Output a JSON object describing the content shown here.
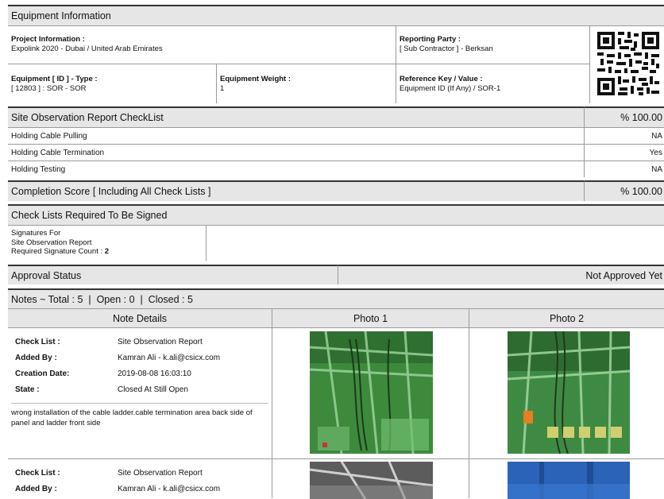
{
  "equipment_info": {
    "title": "Equipment Information",
    "project_label": "Project Information :",
    "project_value": "Expolink 2020 - Dubai / United Arab Emirates",
    "reporting_label": "Reporting Party :",
    "reporting_value": "[ Sub Contractor ] - Berksan",
    "equip_label": "Equipment [ ID ] - Type :",
    "equip_value": "[ 12803 ] : SOR - SOR",
    "weight_label": "Equipment Weight :",
    "weight_value": "1",
    "refkey_label": "Reference Key / Value :",
    "refkey_value": "Equipment ID (If Any) / SOR-1",
    "qr_icon": "qr-code-icon"
  },
  "checklist": {
    "title": "Site Observation Report CheckList",
    "score": "% 100.00",
    "items": [
      {
        "label": "Holding Cable Pulling",
        "value": "NA"
      },
      {
        "label": "Holding Cable Termination",
        "value": "Yes"
      },
      {
        "label": "Holding Testing",
        "value": "NA"
      }
    ]
  },
  "completion": {
    "title": "Completion Score [ Including All Check Lists ]",
    "score": "% 100.00"
  },
  "signatures": {
    "title": "Check Lists Required To Be Signed",
    "line1": "Signatures For",
    "line2": "Site Observation Report",
    "count_label": "Required Signature Count :",
    "count_value": "2"
  },
  "approval": {
    "title": "Approval Status",
    "status": "Not Approved Yet"
  },
  "notes": {
    "summary": "Notes ~ Total : 5  |  Open : 0  |  Closed : 5",
    "col_details": "Note Details",
    "col_photo1": "Photo 1",
    "col_photo2": "Photo 2",
    "entries": [
      {
        "checklist_label": "Check List :",
        "checklist_value": "Site Observation Report",
        "added_label": "Added By :",
        "added_value": "Kamran Ali - k.ali@csicx.com",
        "date_label": "Creation Date:",
        "date_value": "2019-08-08 16:03:10",
        "state_label": "State :",
        "state_value": "Closed At Still Open",
        "description": "wrong installation of the cable ladder.cable termination area back side of panel and ladder front side"
      },
      {
        "checklist_label": "Check List :",
        "checklist_value": "Site Observation Report",
        "added_label": "Added By :",
        "added_value": "Kamran Ali - k.ali@csicx.com"
      }
    ]
  },
  "colors": {
    "header_bg": "#e6e6e6",
    "rule": "#333333",
    "photo_green": "#3f8f3f",
    "photo_blue": "#2a63b8"
  }
}
